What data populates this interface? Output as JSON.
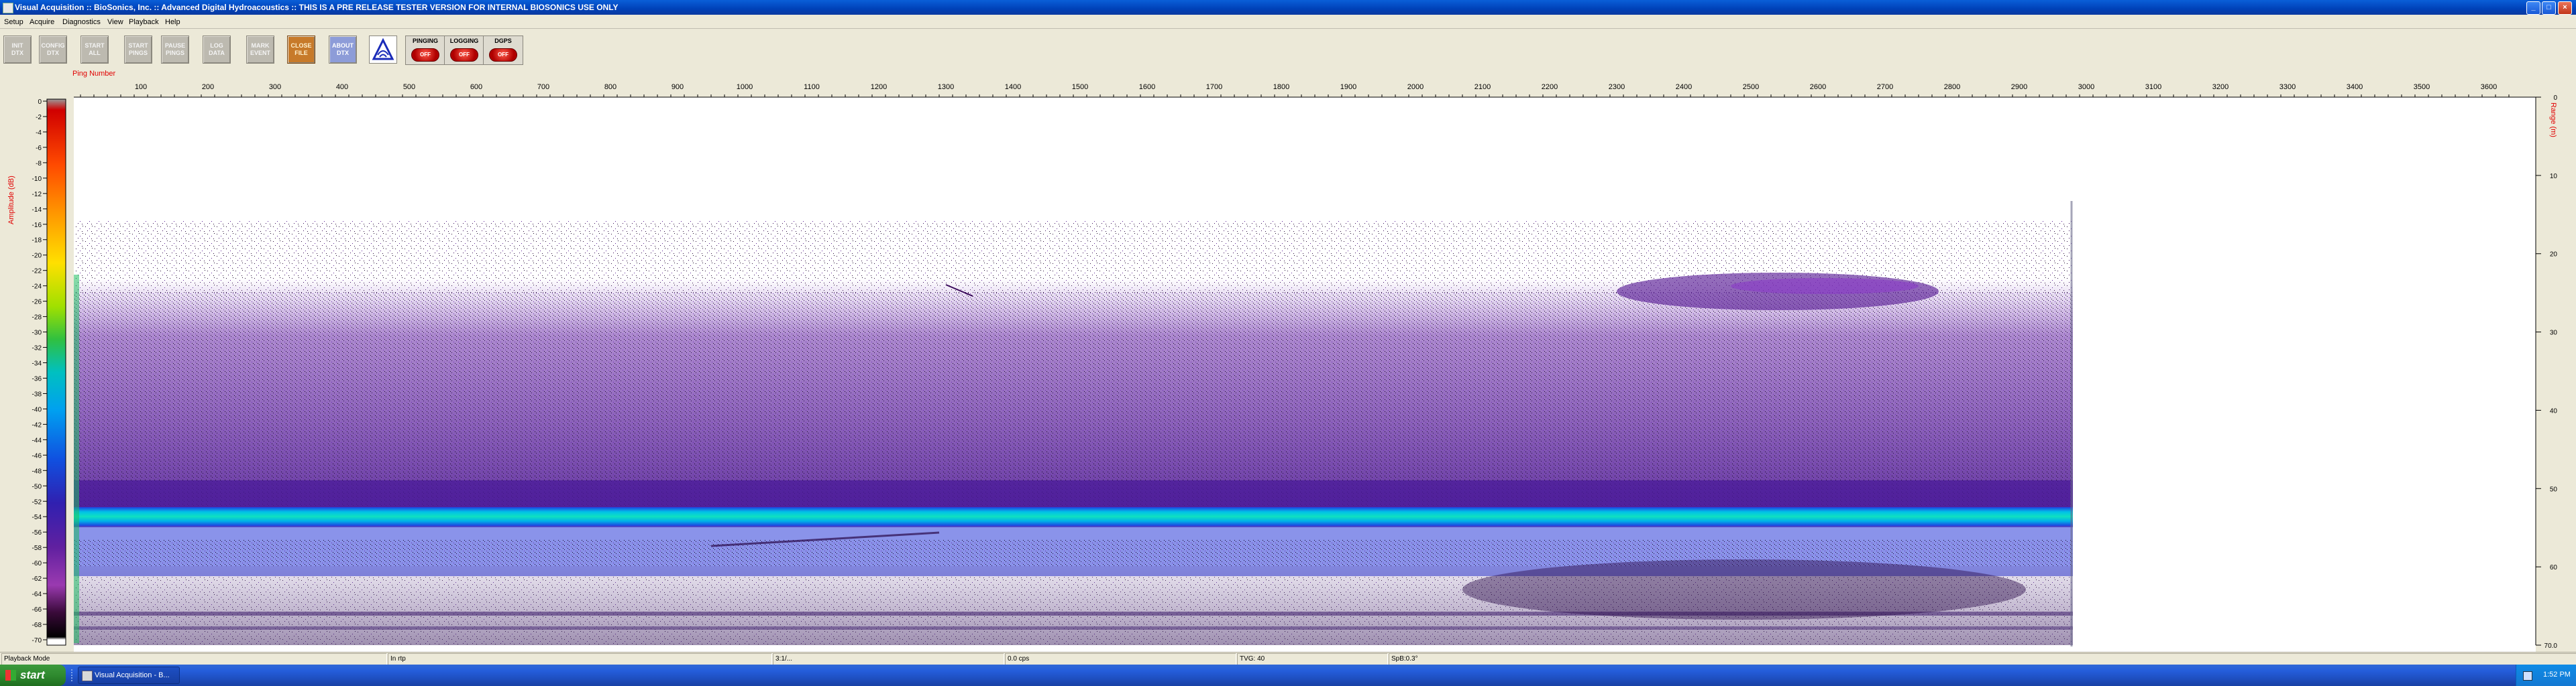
{
  "window": {
    "title": "Visual Acquisition  ::  BioSonics, Inc.  ::  Advanced Digital Hydroacoustics  ::  THIS IS A PRE RELEASE TESTER VERSION FOR INTERNAL BIOSONICS USE ONLY",
    "min_glyph": "_",
    "max_glyph": "□",
    "close_glyph": "×"
  },
  "menu": [
    "Setup",
    "Acquire",
    "Diagnostics",
    "View",
    "Playback",
    "Help"
  ],
  "toolbar": {
    "buttons": [
      {
        "label": "INIT\nDTX"
      },
      {
        "label": "CONFIG\nDTX"
      },
      {
        "label": "START\nALL"
      },
      {
        "label": "START\nPINGS"
      },
      {
        "label": "PAUSE\nPINGS"
      },
      {
        "label": "LOG\nDATA"
      },
      {
        "label": "MARK\nEVENT"
      },
      {
        "label": "CLOSE\nFILE"
      },
      {
        "label": "ABOUT\nDTX"
      }
    ],
    "state_controls": [
      {
        "label": "PINGING",
        "state": "OFF"
      },
      {
        "label": "LOGGING",
        "state": "OFF"
      },
      {
        "label": "DGPS",
        "state": "OFF"
      }
    ]
  },
  "echogram": {
    "x_axis_title": "Ping Number",
    "x_ticks": [
      "100",
      "200",
      "300",
      "400",
      "500",
      "600",
      "700",
      "800",
      "900",
      "1000",
      "1100",
      "1200",
      "1300",
      "1400",
      "1500",
      "1600",
      "1700",
      "1800",
      "1900",
      "2000",
      "2100",
      "2200",
      "2300",
      "2400",
      "2500",
      "2600",
      "2700",
      "2800",
      "2900",
      "3000",
      "3100",
      "3200",
      "3300",
      "3400",
      "3500",
      "3600"
    ],
    "colorbar_title": "Amplitude (dB)",
    "colorbar_ticks": [
      "0",
      "-2",
      "-4",
      "-6",
      "-8",
      "-10",
      "-12",
      "-14",
      "-16",
      "-18",
      "-20",
      "-22",
      "-24",
      "-26",
      "-28",
      "-30",
      "-32",
      "-34",
      "-36",
      "-38",
      "-40",
      "-42",
      "-44",
      "-46",
      "-48",
      "-50",
      "-52",
      "-54",
      "-56",
      "-58",
      "-60",
      "-62",
      "-64",
      "-66",
      "-68",
      "-70"
    ],
    "depth_axis_title": "Range (m)",
    "depth_ticks": [
      "0",
      "10",
      "20",
      "30",
      "40",
      "50",
      "60",
      "70.0"
    ],
    "pings_recorded": 2985,
    "colors": {
      "background": "#ffffff",
      "speckle": "#2a0a3a",
      "layer_purple": "#5a1e96",
      "layer_band": "#00b7e0",
      "layer_blue": "#1e50e0",
      "label_red": "#e00000"
    }
  },
  "statusbar": [
    "Playback Mode",
    "In rtp",
    "3:1/...",
    "0.0 cps",
    "TVG: 40",
    "SpB:0.3°"
  ],
  "taskbar": {
    "start_label": "start",
    "task_label": "Visual Acquisition - B...",
    "clock": "1:52 PM"
  }
}
